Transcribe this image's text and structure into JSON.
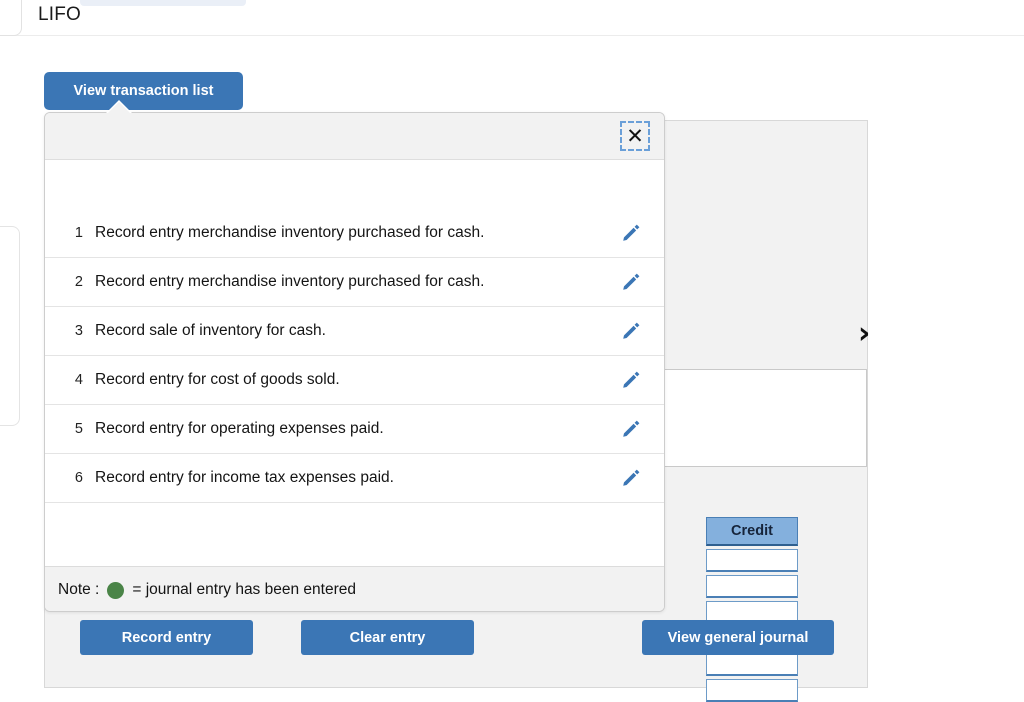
{
  "page": {
    "method_label": "LIFO"
  },
  "toolbar": {
    "view_transaction_list_label": "View transaction list"
  },
  "journal_panel": {
    "chevron_icon": "chevron-right-icon",
    "credit_column": {
      "header": "Credit",
      "rows": [
        "",
        "",
        "",
        "",
        "",
        ""
      ]
    }
  },
  "transaction_popup": {
    "close_label": "✕",
    "close_icon": "close-icon",
    "rows": [
      {
        "num": "1",
        "text": "Record entry merchandise inventory purchased for cash.",
        "edit_icon": "pencil-icon"
      },
      {
        "num": "2",
        "text": "Record entry merchandise inventory purchased for cash.",
        "edit_icon": "pencil-icon"
      },
      {
        "num": "3",
        "text": "Record sale of inventory for cash.",
        "edit_icon": "pencil-icon"
      },
      {
        "num": "4",
        "text": "Record entry for cost of goods sold.",
        "edit_icon": "pencil-icon"
      },
      {
        "num": "5",
        "text": "Record entry for operating expenses paid.",
        "edit_icon": "pencil-icon"
      },
      {
        "num": "6",
        "text": "Record entry for income tax expenses paid.",
        "edit_icon": "pencil-icon"
      }
    ],
    "note": {
      "label": "Note :",
      "dot_icon": "green-dot-icon",
      "text": "= journal entry has been entered",
      "dot_color": "#4a8447"
    }
  },
  "actions": {
    "record_entry_label": "Record entry",
    "clear_entry_label": "Clear entry",
    "view_general_journal_label": "View general journal"
  },
  "colors": {
    "primary_blue": "#3b76b5",
    "credit_header_blue": "#84b0dd",
    "panel_gray": "#f2f2f2",
    "green": "#4a8447"
  }
}
